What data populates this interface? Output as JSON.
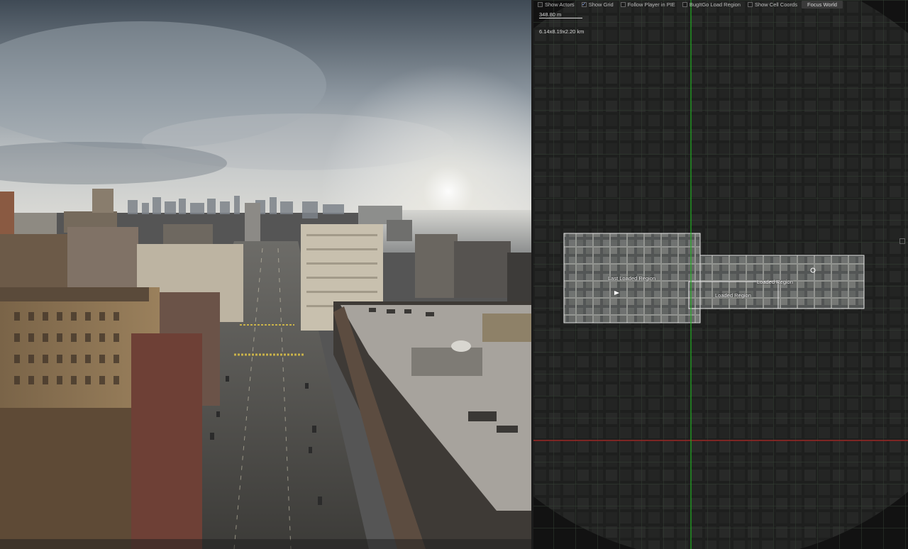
{
  "toolbar": {
    "show_actors": "Show Actors",
    "show_grid": "Show Grid",
    "follow_player": "Follow Player in PIE",
    "bugitgo": "BugItGo Load Region",
    "show_cell_coords": "Show Cell Coords",
    "focus_world": "Focus World"
  },
  "map": {
    "scale_label": "348.80 m",
    "world_size": "6.14x8.19x2.20 km",
    "regions": {
      "last_loaded": "Last Loaded Region",
      "loaded_a": "Loaded Region",
      "loaded_b": "Loaded Region"
    }
  },
  "colors": {
    "grid_line": "#2e3a2e",
    "x_axis": "#b02020",
    "y_axis": "#22b022",
    "region_border": "#e6e6e6",
    "toolbar_button": "#3a3a3a"
  }
}
